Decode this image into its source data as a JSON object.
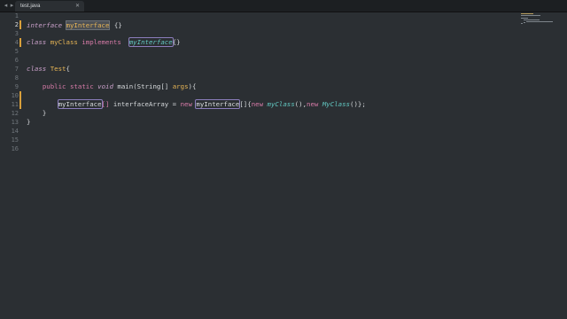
{
  "tabbar": {
    "back_arrow": "◂",
    "forward_arrow": "▸",
    "tab_title": "test.java",
    "close_glyph": "✕"
  },
  "editor": {
    "line_numbers": [
      "1",
      "2",
      "3",
      "4",
      "5",
      "6",
      "7",
      "8",
      "9",
      "10",
      "11",
      "12",
      "13",
      "14",
      "15",
      "16"
    ],
    "active_line": "2",
    "code": {
      "l2": {
        "kw": "interface",
        "name": "myInterface",
        "rest": "{}"
      },
      "l4": {
        "kw": "class",
        "name": "myClass",
        "impl": "implements",
        "iface": "myInterface",
        "rest": "{}"
      },
      "l7": {
        "kw": "class",
        "name": "Test",
        "rest": "{"
      },
      "l9": {
        "mod1": "public",
        "mod2": "static",
        "ret": "void",
        "fn": "main",
        "p1": "(",
        "ptype": "String",
        "arr": "[]",
        "pname": "args",
        "p2": "){"
      },
      "l11": {
        "t1": "myInterface",
        "arr": "[]",
        "var": "interfaceArray",
        "eq": "=",
        "new1": "new",
        "t2": "myInterface",
        "body1": "[]{",
        "new2": "new",
        "c1": "myClass",
        "body2": "(),",
        "new3": "new",
        "c2": "MyClass",
        "body3": "()};"
      },
      "l12": {
        "rest": "}"
      },
      "l13": {
        "rest": "}"
      }
    }
  },
  "colors": {
    "background": "#2b2f33",
    "keyword": "#c9a0c9",
    "class_name": "#e6b455",
    "type": "#62c7c1",
    "modified_marker": "#d9a03b"
  }
}
